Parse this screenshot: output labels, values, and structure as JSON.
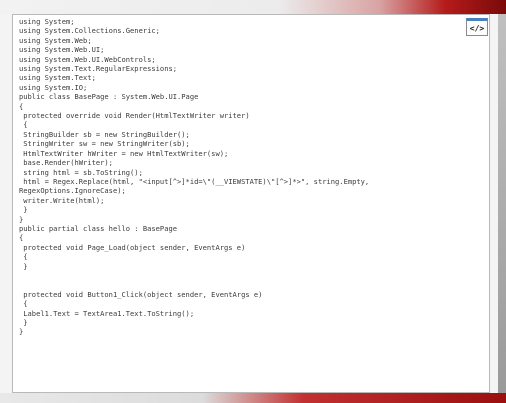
{
  "code_lines": [
    "using System;",
    "using System.Collections.Generic;",
    "using System.Web;",
    "using System.Web.UI;",
    "using System.Web.UI.WebControls;",
    "using System.Text.RegularExpressions;",
    "using System.Text;",
    "using System.IO;",
    "public class BasePage : System.Web.UI.Page",
    "{",
    " protected override void Render(HtmlTextWriter writer)",
    " {",
    " StringBuilder sb = new StringBuilder();",
    " StringWriter sw = new StringWriter(sb);",
    " HtmlTextWriter hWriter = new HtmlTextWriter(sw);",
    " base.Render(hWriter);",
    " string html = sb.ToString();",
    " html = Regex.Replace(html, \"<input[^>]*id=\\\"(__VIEWSTATE)\\\"[^>]*>\", string.Empty,",
    "RegexOptions.IgnoreCase);",
    " writer.Write(html);",
    " }",
    "}",
    "public partial class hello : BasePage",
    "{",
    " protected void Page_Load(object sender, EventArgs e)",
    " {",
    " }",
    "",
    "",
    " protected void Button1_Click(object sender, EventArgs e)",
    " {",
    " Label1.Text = TextArea1.Text.ToString();",
    " }",
    "}"
  ],
  "toolbar": {
    "view_source_label": "</>"
  }
}
